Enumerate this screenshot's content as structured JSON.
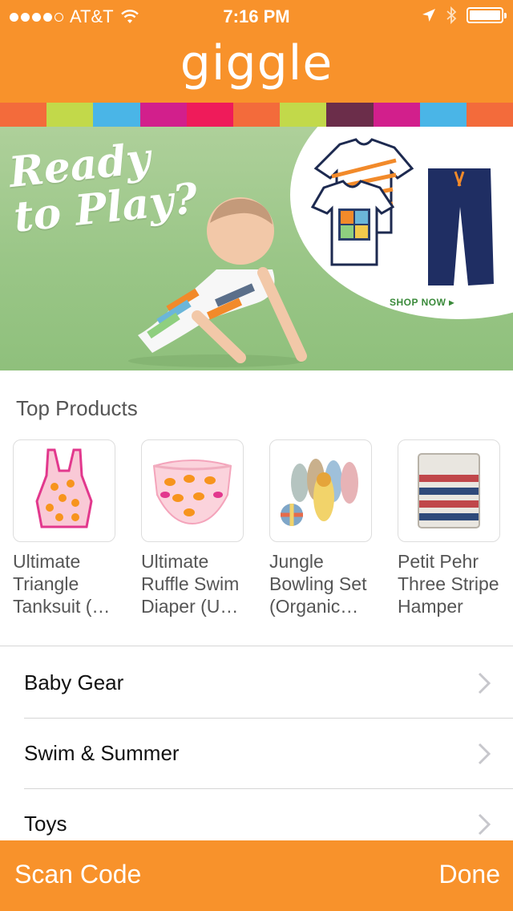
{
  "status_bar": {
    "carrier": "AT&T",
    "time": "7:16 PM"
  },
  "header": {
    "logo_text": "giggle",
    "background_color": "#f8922b"
  },
  "stripe_colors": [
    "#f36b3b",
    "#c2d94a",
    "#4ab5e7",
    "#d21f8c",
    "#ef1b5a",
    "#f36b3b",
    "#c2d94a",
    "#6b2d4a",
    "#d21f8c",
    "#4ab5e7",
    "#f36b3b"
  ],
  "banner": {
    "headline_line1": "Ready",
    "headline_line2": "to Play?",
    "cta": "SHOP NOW ▸"
  },
  "top_products": {
    "title": "Top Products",
    "items": [
      {
        "name": "Ultimate Triangle Tanksuit (…",
        "icon": "tanksuit-icon"
      },
      {
        "name": "Ultimate Ruffle Swim Diaper (U…",
        "icon": "swim-diaper-icon"
      },
      {
        "name": "Jungle Bowling Set (Organic…",
        "icon": "bowling-set-icon"
      },
      {
        "name": "Petit Pehr Three Stripe Hamper",
        "icon": "hamper-icon"
      }
    ]
  },
  "categories": [
    {
      "label": "Baby Gear"
    },
    {
      "label": "Swim & Summer"
    },
    {
      "label": "Toys"
    }
  ],
  "bottom_bar": {
    "scan_label": "Scan Code",
    "done_label": "Done"
  }
}
